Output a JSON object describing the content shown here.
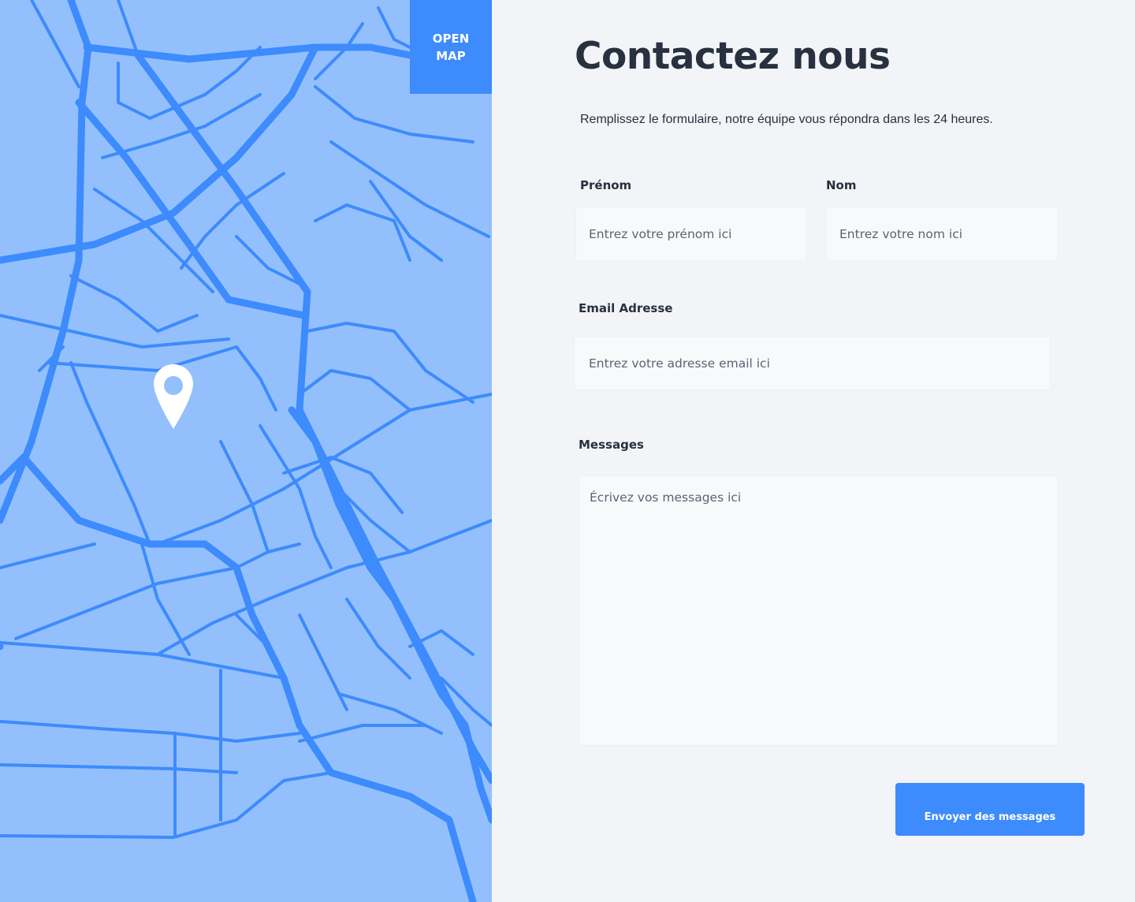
{
  "map": {
    "open_button_line1": "OPEN",
    "open_button_line2": "MAP",
    "pin_icon": "location-pin-icon",
    "colors": {
      "water": "#93C0FC",
      "streets": "#3D8BFD",
      "pin": "#FFFFFF"
    }
  },
  "form": {
    "title": "Contactez nous",
    "subtitle": "Remplissez le formulaire, notre équipe vous répondra dans les 24 heures.",
    "first_name": {
      "label": "Prénom",
      "placeholder": "Entrez votre prénom ici"
    },
    "last_name": {
      "label": "Nom",
      "placeholder": "Entrez votre nom ici"
    },
    "email": {
      "label": "Email Adresse",
      "placeholder": "Entrez votre adresse email ici"
    },
    "message": {
      "label": "Messages",
      "placeholder": "Écrivez vos messages ici"
    },
    "submit_label": "Envoyer des messages",
    "colors": {
      "background": "#F2F4F7",
      "text": "#27313F",
      "accent": "#3D8BFD",
      "field": "#F8F9FB"
    }
  }
}
